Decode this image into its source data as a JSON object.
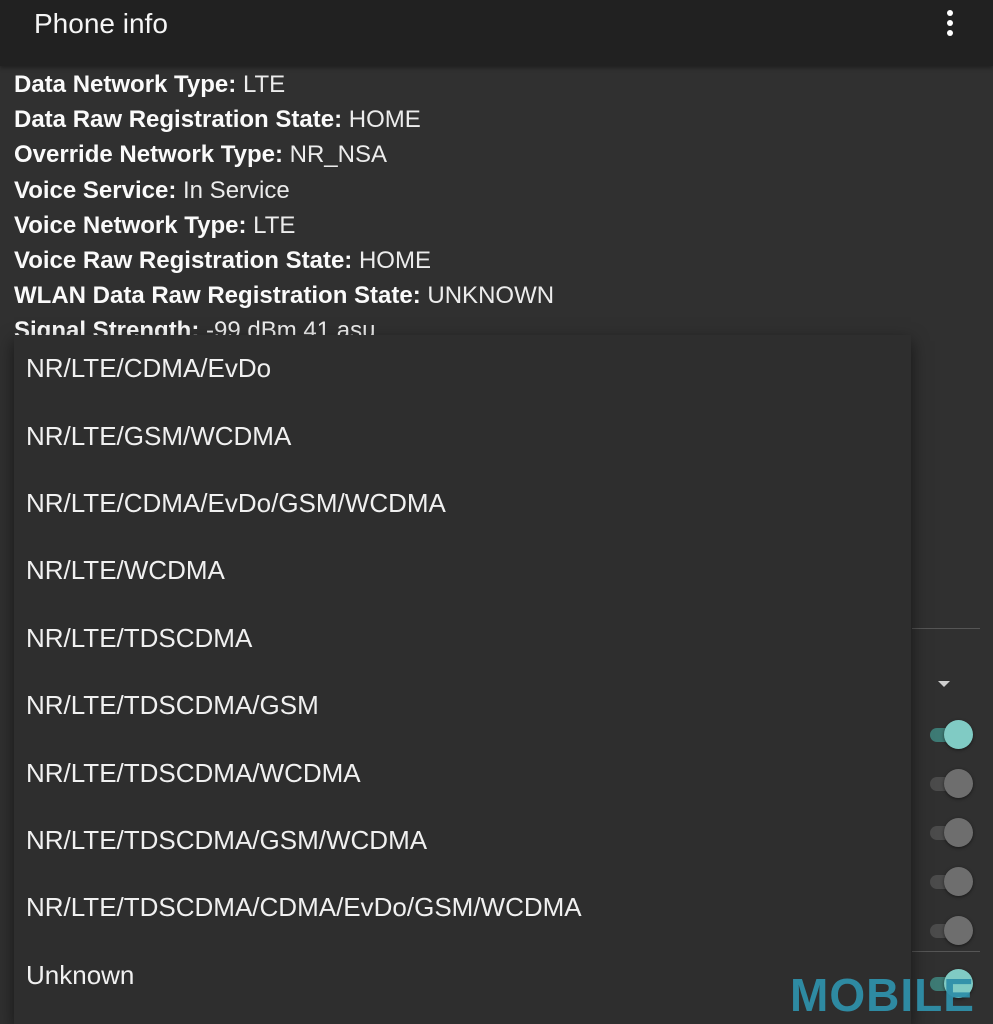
{
  "app_bar": {
    "title": "Phone info",
    "overflow_icon": "more-vert-icon"
  },
  "info": {
    "rows": [
      {
        "key": "Data Network Type:",
        "value": "LTE"
      },
      {
        "key": "Data Raw Registration State:",
        "value": "HOME"
      },
      {
        "key": "Override Network Type:",
        "value": "NR_NSA"
      },
      {
        "key": "Voice Service:",
        "value": "In Service"
      },
      {
        "key": "Voice Network Type:",
        "value": "LTE"
      },
      {
        "key": "Voice Raw Registration State:",
        "value": "HOME"
      },
      {
        "key": "WLAN Data Raw Registration State:",
        "value": "UNKNOWN"
      },
      {
        "key": "Signal Strength:",
        "value": "-99 dBm   41 asu"
      }
    ]
  },
  "dropdown": {
    "options": [
      "NR/LTE/CDMA/EvDo",
      "NR/LTE/GSM/WCDMA",
      "NR/LTE/CDMA/EvDo/GSM/WCDMA",
      "NR/LTE/WCDMA",
      "NR/LTE/TDSCDMA",
      "NR/LTE/TDSCDMA/GSM",
      "NR/LTE/TDSCDMA/WCDMA",
      "NR/LTE/TDSCDMA/GSM/WCDMA",
      "NR/LTE/TDSCDMA/CDMA/EvDo/GSM/WCDMA",
      "Unknown"
    ]
  },
  "toggles": [
    {
      "state": "on"
    },
    {
      "state": "off"
    },
    {
      "state": "off"
    },
    {
      "state": "off"
    },
    {
      "state": "off"
    },
    {
      "state": "on"
    }
  ],
  "colors": {
    "accent": "#80cbc4",
    "background": "#303030",
    "app_bar": "#212121",
    "menu": "#2e2e2e"
  },
  "watermark": {
    "text": "MOBILE"
  }
}
